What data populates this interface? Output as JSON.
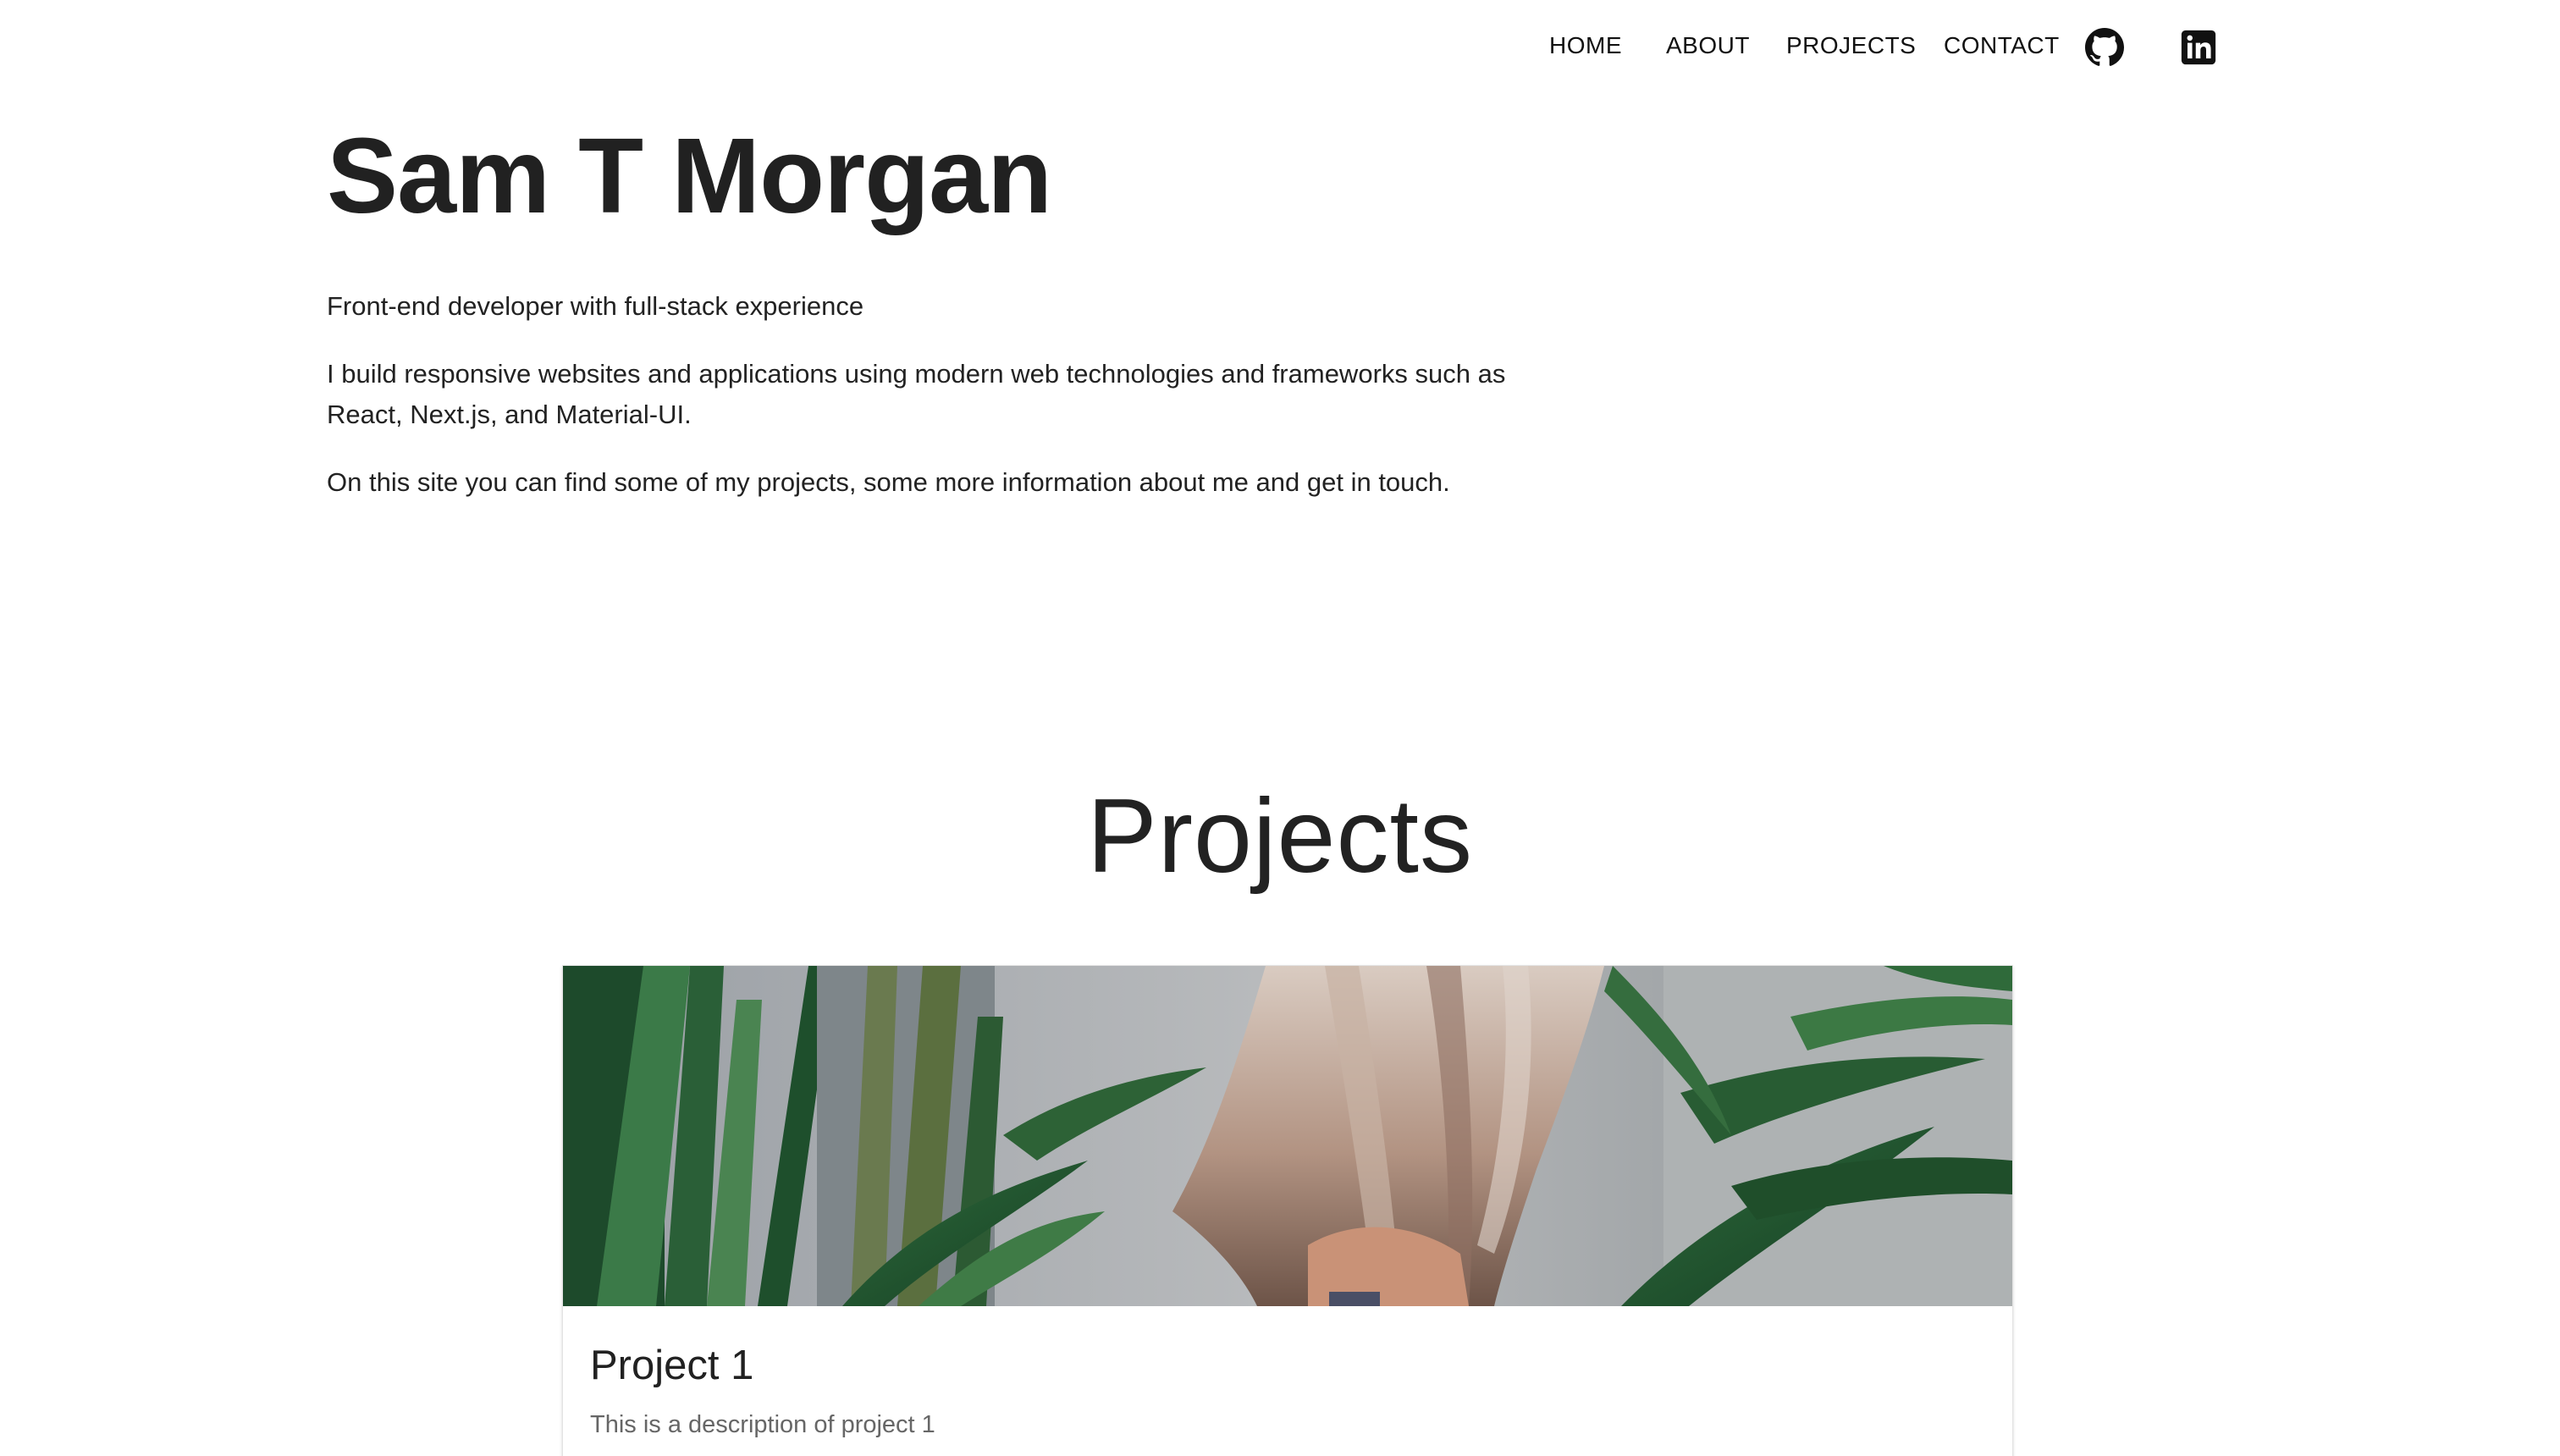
{
  "nav": {
    "links": [
      {
        "label": "HOME"
      },
      {
        "label": "ABOUT"
      },
      {
        "label": "PROJECTS"
      },
      {
        "label": "CONTACT"
      }
    ],
    "icons": [
      "github-icon",
      "linkedin-icon"
    ]
  },
  "hero": {
    "name": "Sam T Morgan",
    "tagline": "Front-end developer with full-stack experience",
    "description": "I build responsive websites and applications using modern web technologies and frameworks such as React, Next.js, and Material-UI.",
    "site_info": "On this site you can find some of my projects, some more information about me and get in touch."
  },
  "projects": {
    "heading": "Projects",
    "items": [
      {
        "title": "Project 1",
        "description": "This is a description of project 1"
      }
    ]
  },
  "colors": {
    "text": "#222222",
    "muted": "#666666",
    "background": "#ffffff"
  }
}
